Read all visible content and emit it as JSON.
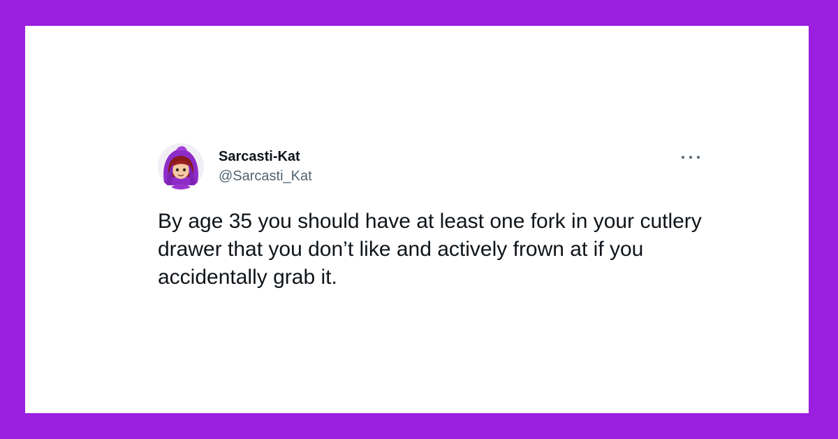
{
  "tweet": {
    "display_name": "Sarcasti-Kat",
    "handle": "@Sarcasti_Kat",
    "text": "By age 35 you should have at least one fork in your cutlery drawer that you don’t like and actively frown at if you accidentally grab it.",
    "avatar_icon": "hooded-cartoon-girl-avatar",
    "more_icon": "more-options-icon"
  },
  "colors": {
    "frame": "#9b1fdf",
    "card": "#ffffff",
    "name_text": "#0f1419",
    "handle_text": "#536471"
  }
}
